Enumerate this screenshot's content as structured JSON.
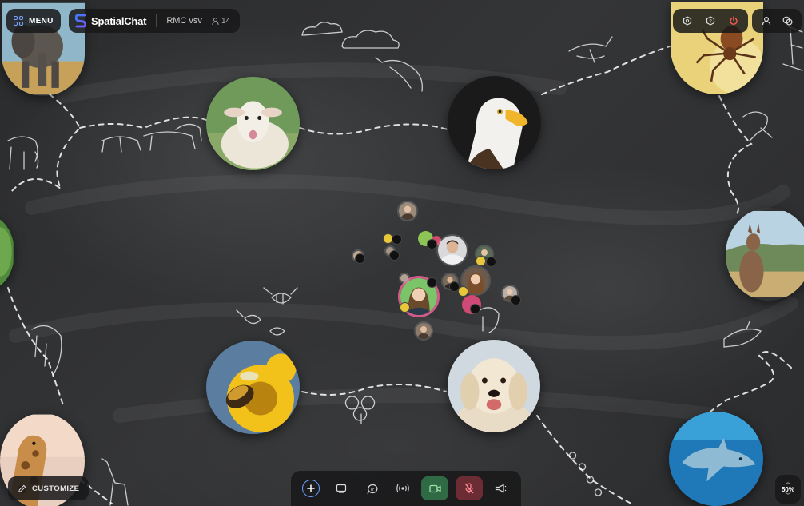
{
  "app": {
    "menu_label": "MENU",
    "brand": "SpatialChat",
    "room_name": "RMC vsv",
    "participant_count": "14"
  },
  "top_right": {
    "icons_a": [
      "settings-hex-icon",
      "help-icon",
      "power-icon"
    ],
    "icons_b": [
      "profile-icon",
      "chat-bubbles-icon"
    ]
  },
  "animals": [
    "elephant",
    "sheep",
    "eagle",
    "spider",
    "kangaroo",
    "bee",
    "dog",
    "giraffe",
    "dolphin",
    "leaf"
  ],
  "bottom": {
    "customize_label": "CUSTOMIZE",
    "toolbar": [
      "add-icon",
      "screen-share-icon",
      "chat-icon",
      "broadcast-icon",
      "camera-icon",
      "mic-muted-icon",
      "megaphone-icon"
    ],
    "zoom": "50%"
  },
  "colors": {
    "accent_blue": "#6aa0ff",
    "camera_on": "#2f6a45",
    "mic_muted": "#6b2c34",
    "chalkboard": "#2e2f31"
  }
}
